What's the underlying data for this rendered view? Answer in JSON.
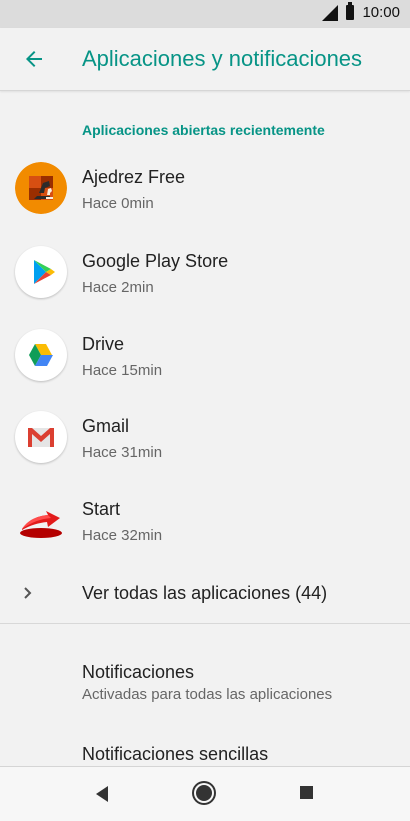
{
  "status": {
    "time": "10:00"
  },
  "header": {
    "title": "Aplicaciones y notificaciones"
  },
  "recent": {
    "label": "Aplicaciones abiertas recientemente",
    "apps": [
      {
        "name": "Ajedrez Free",
        "time": "Hace 0min",
        "icon": "chess-icon"
      },
      {
        "name": "Google Play Store",
        "time": "Hace 2min",
        "icon": "play-store-icon"
      },
      {
        "name": "Drive",
        "time": "Hace 15min",
        "icon": "drive-icon"
      },
      {
        "name": "Gmail",
        "time": "Hace 31min",
        "icon": "gmail-icon"
      },
      {
        "name": "Start",
        "time": "Hace 32min",
        "icon": "start-arrow-icon"
      }
    ],
    "see_all": "Ver todas las aplicaciones (44)"
  },
  "notifications": {
    "title": "Notificaciones",
    "subtitle": "Activadas para todas las aplicaciones"
  },
  "simple_notifications": {
    "title": "Notificaciones sencillas"
  },
  "colors": {
    "accent": "#079486",
    "status_bar": "#dcdcdc",
    "background": "#f2f2f2"
  }
}
